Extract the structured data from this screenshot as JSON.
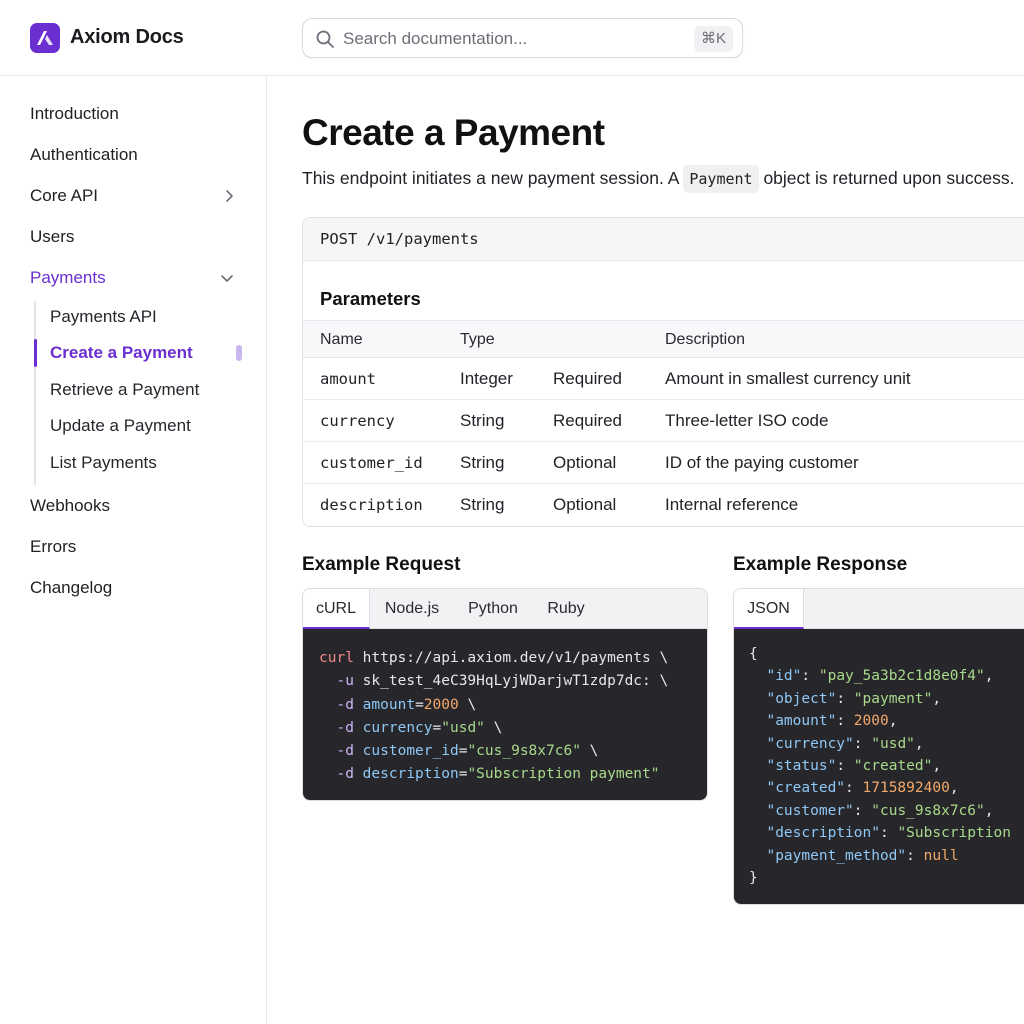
{
  "header": {
    "brand": "Axiom Docs",
    "search_placeholder": "Search documentation...",
    "search_shortcut": "⌘K",
    "accent": "#6b2fd1"
  },
  "sidebar": {
    "items": [
      {
        "label": "Introduction"
      },
      {
        "label": "Authentication"
      },
      {
        "label": "Core API",
        "icon": "chevron-right-icon"
      },
      {
        "label": "Users"
      },
      {
        "label": "Payments",
        "icon": "chevron-down-icon",
        "active": true
      },
      {
        "label": "Webhooks"
      },
      {
        "label": "Errors"
      },
      {
        "label": "Changelog"
      }
    ],
    "sub_items": [
      {
        "label": "Payments API"
      },
      {
        "label": "Create a Payment",
        "active": true
      },
      {
        "label": "Retrieve a Payment"
      },
      {
        "label": "Update a Payment"
      },
      {
        "label": "List Payments"
      }
    ]
  },
  "main": {
    "title": "Create a Payment",
    "lead_before": "This endpoint initiates a new payment session. A",
    "lead_code": "Payment",
    "lead_after": "object is returned upon success.",
    "endpoint": "POST /v1/payments",
    "params_title": "Parameters",
    "columns": [
      "Name",
      "Type",
      "Description"
    ],
    "params": [
      {
        "name": "amount",
        "type": "Integer",
        "req": "Required",
        "desc": "Amount in smallest currency unit"
      },
      {
        "name": "currency",
        "type": "String",
        "req": "Required",
        "desc": "Three-letter ISO code"
      },
      {
        "name": "customer_id",
        "type": "String",
        "req": "Optional",
        "desc": "ID of the paying customer"
      },
      {
        "name": "description",
        "type": "String",
        "req": "Optional",
        "desc": "Internal reference"
      }
    ],
    "request": {
      "title": "Example Request",
      "tabs": [
        "cURL",
        "Node.js",
        "Python",
        "Ruby"
      ],
      "active_tab": "cURL",
      "cmd": "curl",
      "url": "https://api.axiom.dev/v1/payments \\",
      "auth_flag": "-u",
      "auth_value": "sk_test_4eC39HqLyjWDarjwT1zdp7dc: \\",
      "data_flag": "-d",
      "lines": [
        {
          "key": "amount",
          "value": "2000",
          "kind": "num"
        },
        {
          "key": "currency",
          "value": "\"usd\"",
          "kind": "str"
        },
        {
          "key": "customer_id",
          "value": "\"cus_9s8x7c6\"",
          "kind": "str"
        },
        {
          "key": "description",
          "value": "\"Subscription payment\"",
          "kind": "str",
          "last": true
        }
      ]
    },
    "response": {
      "title": "Example Response",
      "tab": "JSON",
      "open": "{",
      "close": "}",
      "fields": [
        {
          "key": "\"id\"",
          "value": "\"pay_5a3b2c1d8e0f4\"",
          "kind": "str"
        },
        {
          "key": "\"object\"",
          "value": "\"payment\"",
          "kind": "str"
        },
        {
          "key": "\"amount\"",
          "value": "2000",
          "kind": "num"
        },
        {
          "key": "\"currency\"",
          "value": "\"usd\"",
          "kind": "str"
        },
        {
          "key": "\"status\"",
          "value": "\"created\"",
          "kind": "str"
        },
        {
          "key": "\"created\"",
          "value": "1715892400",
          "kind": "num"
        },
        {
          "key": "\"customer\"",
          "value": "\"cus_9s8x7c6\"",
          "kind": "str"
        },
        {
          "key": "\"description\"",
          "value": "\"Subscription",
          "kind": "str",
          "truncated": true
        },
        {
          "key": "\"payment_method\"",
          "value": "null",
          "kind": "null",
          "last": true
        }
      ]
    }
  }
}
